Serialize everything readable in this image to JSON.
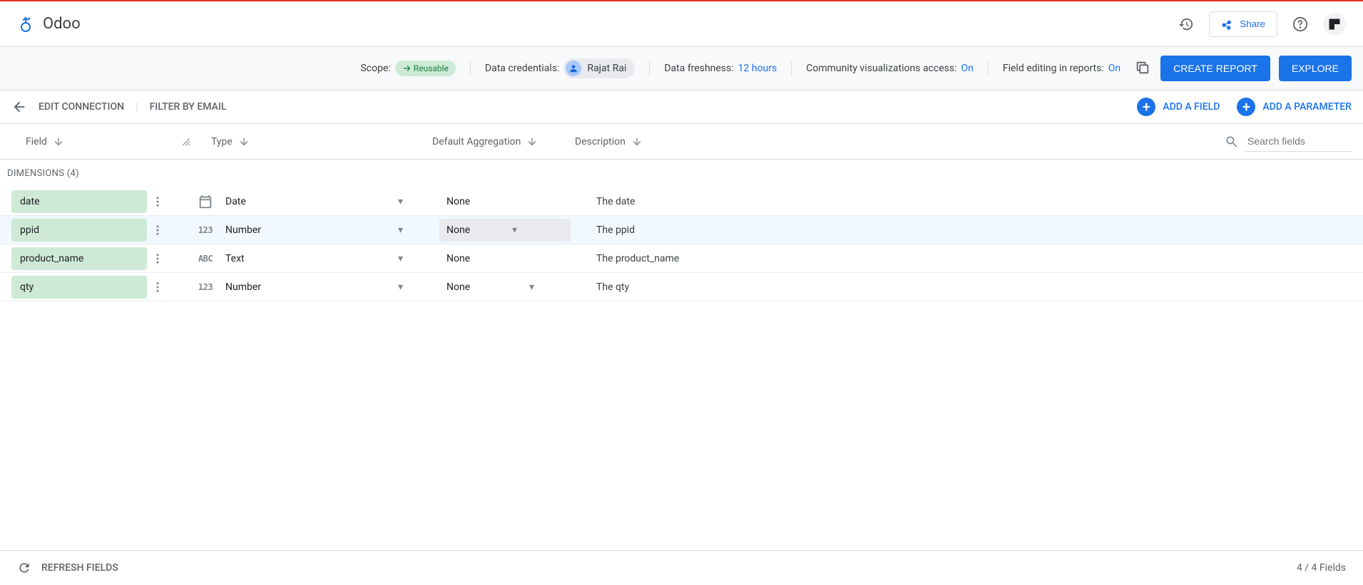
{
  "header": {
    "title": "Odoo",
    "share_label": "Share"
  },
  "info_bar": {
    "scope_label": "Scope:",
    "scope_value": "Reusable",
    "credentials_label": "Data credentials:",
    "credentials_user": "Rajat Rai",
    "freshness_label": "Data freshness:",
    "freshness_value": "12 hours",
    "viz_label": "Community visualizations access:",
    "viz_value": "On",
    "field_edit_label": "Field editing in reports:",
    "field_edit_value": "On",
    "create_report": "CREATE REPORT",
    "explore": "EXPLORE"
  },
  "action_bar": {
    "edit_connection": "EDIT CONNECTION",
    "filter_by_email": "FILTER BY EMAIL",
    "add_field": "ADD A FIELD",
    "add_parameter": "ADD A PARAMETER"
  },
  "columns": {
    "field": "Field",
    "type": "Type",
    "agg": "Default Aggregation",
    "desc": "Description",
    "search_placeholder": "Search fields"
  },
  "section": {
    "dimensions": "DIMENSIONS (4)"
  },
  "rows": [
    {
      "name": "date",
      "type": "Date",
      "agg": "None",
      "desc": "The date",
      "icon": "calendar",
      "highlighted": false,
      "agg_dropdown": false
    },
    {
      "name": "ppid",
      "type": "Number",
      "agg": "None",
      "desc": "The ppid",
      "icon": "number",
      "highlighted": true,
      "agg_dropdown": true
    },
    {
      "name": "product_name",
      "type": "Text",
      "agg": "None",
      "desc": "The product_name",
      "icon": "text",
      "highlighted": false,
      "agg_dropdown": false
    },
    {
      "name": "qty",
      "type": "Number",
      "agg": "None",
      "desc": "The qty",
      "icon": "number",
      "highlighted": false,
      "agg_dropdown": true
    }
  ],
  "footer": {
    "refresh": "REFRESH FIELDS",
    "count": "4 / 4 Fields"
  }
}
